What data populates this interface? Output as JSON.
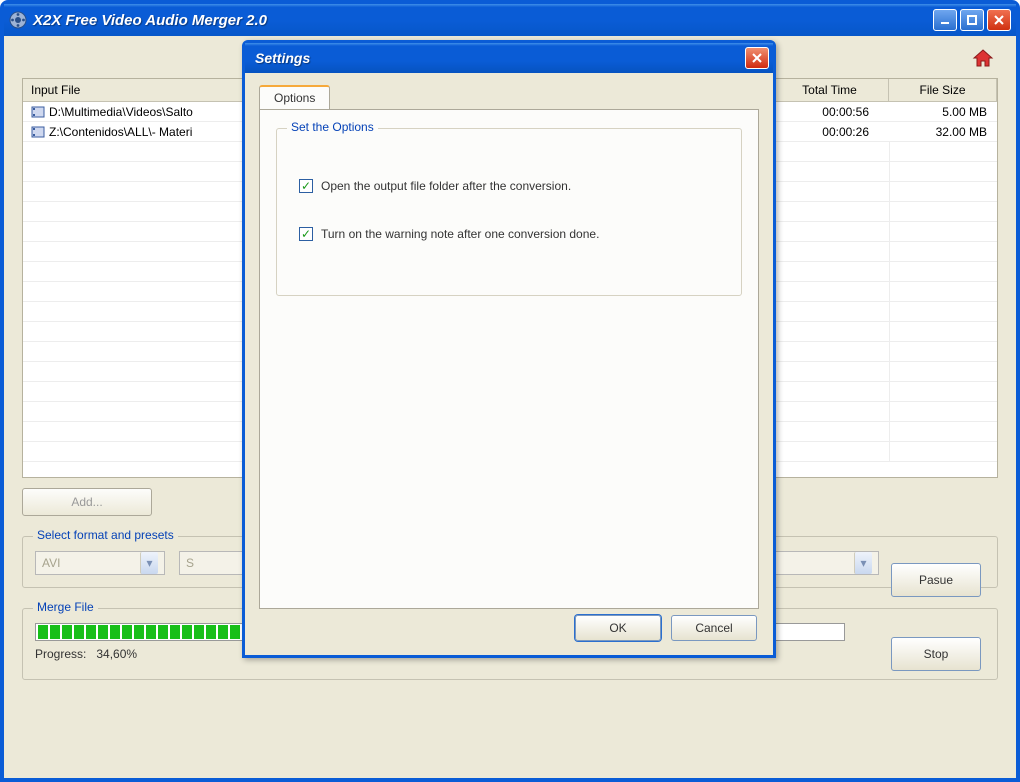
{
  "window": {
    "title": "X2X Free Video Audio Merger 2.0"
  },
  "home_icon": "home-icon",
  "filelist": {
    "columns": {
      "input": "Input File",
      "time": "Total Time",
      "size": "File Size"
    },
    "rows": [
      {
        "name": "D:\\Multimedia\\Videos\\Salto",
        "time": "00:00:56",
        "size": "5.00 MB"
      },
      {
        "name": "Z:\\Contenidos\\ALL\\- Materi",
        "time": "00:00:26",
        "size": "32.00 MB"
      }
    ]
  },
  "buttons": {
    "add": "Add...",
    "pause": "Pasue",
    "stop": "Stop"
  },
  "format_group": {
    "legend": "Select format and presets",
    "combo1": "AVI",
    "combo2": "S"
  },
  "merge_group": {
    "legend": "Merge File",
    "progress_label": "Progress:",
    "progress_value": "34,60%",
    "progress_segments": 24
  },
  "settings_dialog": {
    "title": "Settings",
    "tab_label": "Options",
    "inner_legend": "Set the Options",
    "option1": "Open the output file folder after the conversion.",
    "option2": "Turn on the warning note after one conversion done.",
    "ok": "OK",
    "cancel": "Cancel"
  }
}
